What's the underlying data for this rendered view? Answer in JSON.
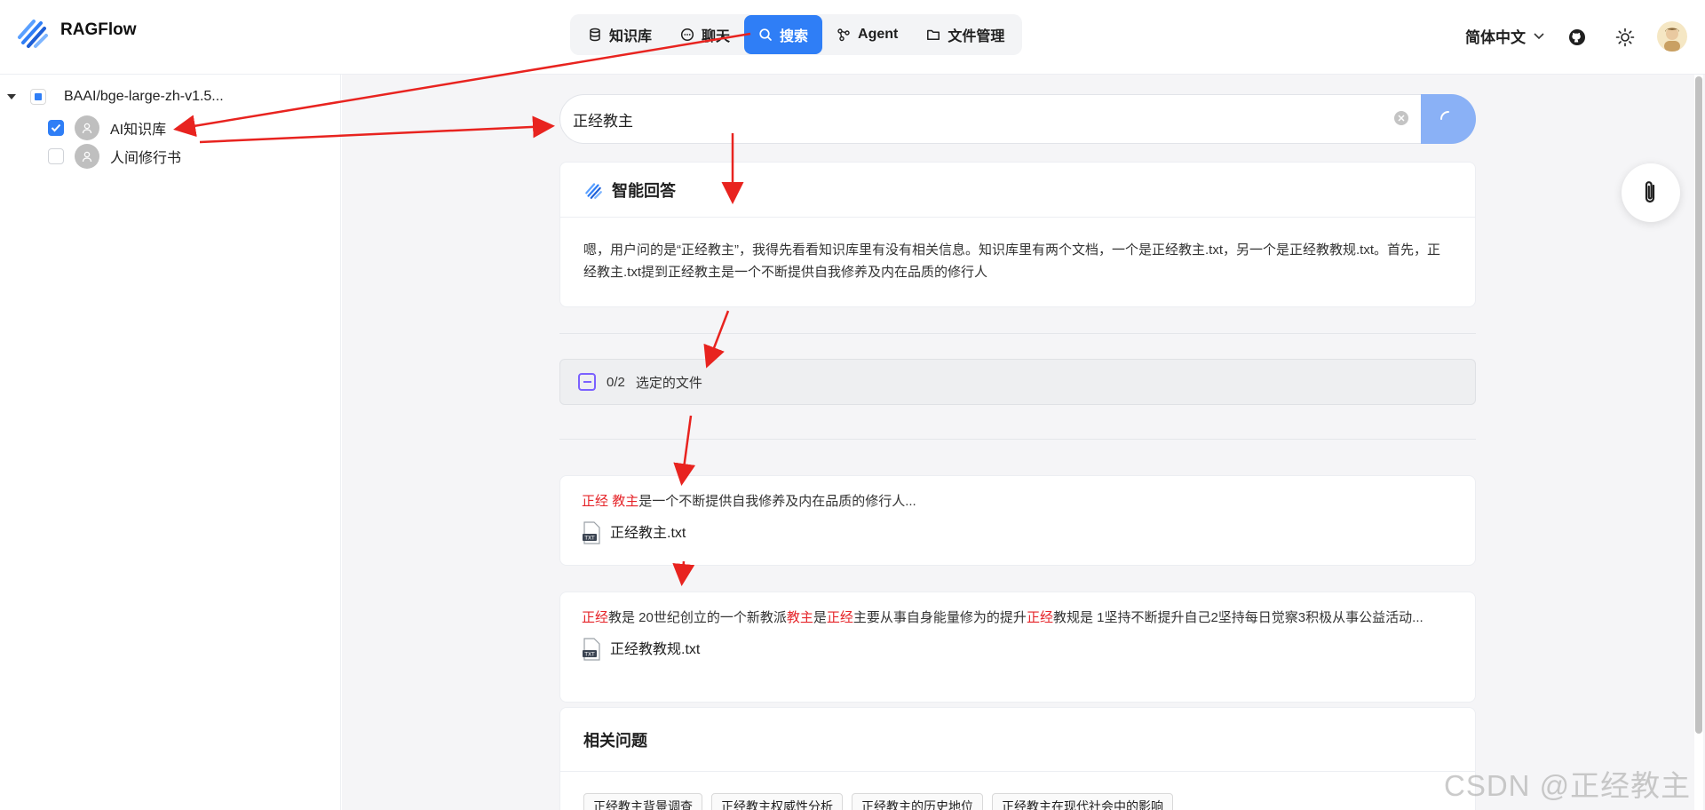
{
  "app": {
    "brand": "RAGFlow"
  },
  "nav": {
    "items": [
      {
        "label": "知识库",
        "icon": "database-icon",
        "active": false
      },
      {
        "label": "聊天",
        "icon": "chat-bubble-icon",
        "active": false
      },
      {
        "label": "搜索",
        "icon": "search-icon",
        "active": true
      },
      {
        "label": "Agent",
        "icon": "graph-nodes-icon",
        "active": false
      },
      {
        "label": "文件管理",
        "icon": "folder-icon",
        "active": false
      }
    ]
  },
  "header": {
    "language": "简体中文"
  },
  "sidebar": {
    "root_label": "BAAI/bge-large-zh-v1.5...",
    "items": [
      {
        "label": "AI知识库",
        "checked": true
      },
      {
        "label": "人间修行书",
        "checked": false
      }
    ]
  },
  "search": {
    "value": "正经教主"
  },
  "answer": {
    "title": "智能回答",
    "text": "嗯，用户问的是“正经教主”，我得先看看知识库里有没有相关信息。知识库里有两个文档，一个是正经教主.txt，另一个是正经教教规.txt。首先，正经教主.txt提到正经教主是一个不断提供自我修养及内在品质的修行人"
  },
  "selection": {
    "count": "0/2",
    "label": "选定的文件"
  },
  "results": [
    {
      "segments": [
        {
          "text": "正经",
          "hl": true
        },
        {
          "text": " ",
          "hl": false
        },
        {
          "text": "教主",
          "hl": true
        },
        {
          "text": "是一个不断提供自我修养及内在品质的修行人...",
          "hl": false
        }
      ],
      "file": "正经教主.txt"
    },
    {
      "segments": [
        {
          "text": "正经",
          "hl": true
        },
        {
          "text": "教是 20世纪创立的一个新教派",
          "hl": false
        },
        {
          "text": "教主",
          "hl": true
        },
        {
          "text": "是",
          "hl": false
        },
        {
          "text": "正经",
          "hl": true
        },
        {
          "text": "主要从事自身能量修为的提升",
          "hl": false
        },
        {
          "text": "正经",
          "hl": true
        },
        {
          "text": "教规是 1坚持不断提升自己2坚持每日觉察3积极从事公益活动...",
          "hl": false
        }
      ],
      "file": "正经教教规.txt"
    }
  ],
  "related": {
    "title": "相关问题",
    "tags": [
      "正经教主背景调查",
      "正经教主权威性分析",
      "正经教主的历史地位",
      "正经教主在现代社会中的影响"
    ]
  },
  "watermark": "CSDN @正经教主",
  "colors": {
    "accent": "#2f7ef6",
    "highlight": "#e5252a",
    "annotation_arrow": "#e8231f"
  }
}
